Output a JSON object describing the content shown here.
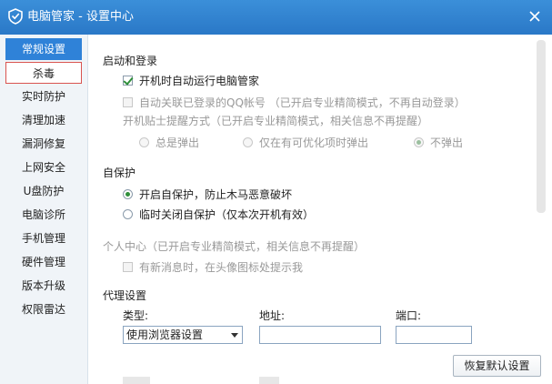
{
  "window": {
    "title": "电脑管家 - 设置中心",
    "logo_icon": "shield-icon",
    "close_icon": "close-icon"
  },
  "sidebar": {
    "items": [
      {
        "label": "常规设置",
        "state": "active"
      },
      {
        "label": "杀毒",
        "state": "hover"
      },
      {
        "label": "实时防护"
      },
      {
        "label": "清理加速"
      },
      {
        "label": "漏洞修复"
      },
      {
        "label": "上网安全"
      },
      {
        "label": "U盘防护"
      },
      {
        "label": "电脑诊所"
      },
      {
        "label": "手机管理"
      },
      {
        "label": "硬件管理"
      },
      {
        "label": "版本升级"
      },
      {
        "label": "权限雷达"
      }
    ]
  },
  "startup": {
    "heading": "启动和登录",
    "auto_run": {
      "label": "开机时自动运行电脑管家",
      "checked": true
    },
    "qq_login": {
      "label": "自动关联已登录的QQ帐号 （已开启专业精简模式，不再自动登录）",
      "checked": false,
      "disabled": true
    },
    "tip_mode": {
      "label": "开机贴士提醒方式（已开启专业精简模式，相关信息不再提醒）",
      "options": [
        "总是弹出",
        "仅在有可优化项时弹出",
        "不弹出"
      ],
      "selected": "不弹出",
      "disabled": true
    }
  },
  "self_protect": {
    "heading": "自保护",
    "options": [
      "开启自保护，防止木马恶意破坏",
      "临时关闭自保护（仅本次开机有效）"
    ],
    "selected": "开启自保护，防止木马恶意破坏"
  },
  "personal_center": {
    "heading": "个人中心（已开启专业精简模式，相关信息不再提醒）",
    "new_message": {
      "label": "有新消息时，在头像图标处提示我",
      "checked": false,
      "disabled": true
    }
  },
  "proxy": {
    "heading": "代理设置",
    "type_label": "类型:",
    "type_value": "使用浏览器设置",
    "address_label": "地址:",
    "address_value": "",
    "port_label": "端口:",
    "port_value": ""
  },
  "footer": {
    "restore_label": "恢复默认设置"
  }
}
